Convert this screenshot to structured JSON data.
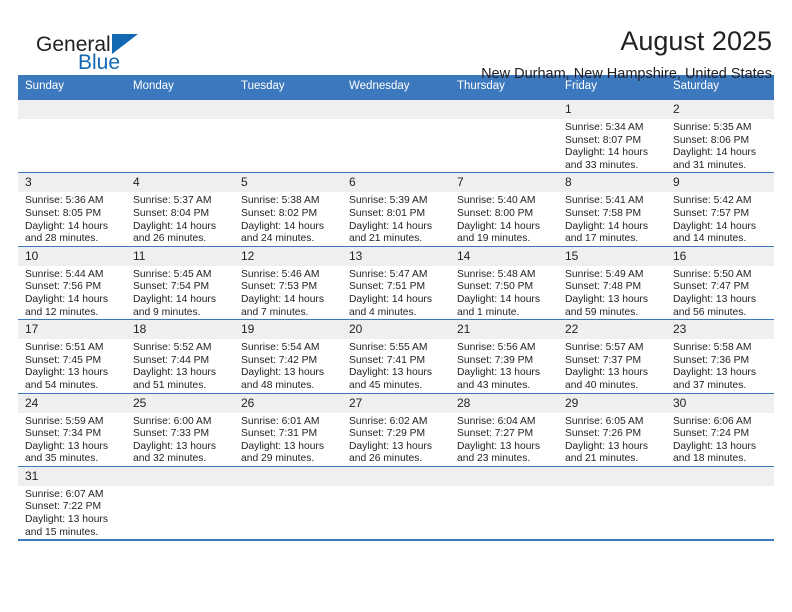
{
  "brand": {
    "name_part1": "General",
    "name_part2": "Blue",
    "mark": "triangle-icon"
  },
  "header": {
    "title": "August 2025",
    "subtitle": "New Durham, New Hampshire, United States"
  },
  "colors": {
    "header_blue": "#3C78BE",
    "brand_blue": "#1268B3",
    "daynum_band": "#EFEFEF",
    "text": "#231F20"
  },
  "weekday_headers": [
    "Sunday",
    "Monday",
    "Tuesday",
    "Wednesday",
    "Thursday",
    "Friday",
    "Saturday"
  ],
  "weeks": [
    [
      {
        "day": "",
        "sunrise": "",
        "sunset": "",
        "daylight1": "",
        "daylight2": ""
      },
      {
        "day": "",
        "sunrise": "",
        "sunset": "",
        "daylight1": "",
        "daylight2": ""
      },
      {
        "day": "",
        "sunrise": "",
        "sunset": "",
        "daylight1": "",
        "daylight2": ""
      },
      {
        "day": "",
        "sunrise": "",
        "sunset": "",
        "daylight1": "",
        "daylight2": ""
      },
      {
        "day": "",
        "sunrise": "",
        "sunset": "",
        "daylight1": "",
        "daylight2": ""
      },
      {
        "day": "1",
        "sunrise": "Sunrise: 5:34 AM",
        "sunset": "Sunset: 8:07 PM",
        "daylight1": "Daylight: 14 hours",
        "daylight2": "and 33 minutes."
      },
      {
        "day": "2",
        "sunrise": "Sunrise: 5:35 AM",
        "sunset": "Sunset: 8:06 PM",
        "daylight1": "Daylight: 14 hours",
        "daylight2": "and 31 minutes."
      }
    ],
    [
      {
        "day": "3",
        "sunrise": "Sunrise: 5:36 AM",
        "sunset": "Sunset: 8:05 PM",
        "daylight1": "Daylight: 14 hours",
        "daylight2": "and 28 minutes."
      },
      {
        "day": "4",
        "sunrise": "Sunrise: 5:37 AM",
        "sunset": "Sunset: 8:04 PM",
        "daylight1": "Daylight: 14 hours",
        "daylight2": "and 26 minutes."
      },
      {
        "day": "5",
        "sunrise": "Sunrise: 5:38 AM",
        "sunset": "Sunset: 8:02 PM",
        "daylight1": "Daylight: 14 hours",
        "daylight2": "and 24 minutes."
      },
      {
        "day": "6",
        "sunrise": "Sunrise: 5:39 AM",
        "sunset": "Sunset: 8:01 PM",
        "daylight1": "Daylight: 14 hours",
        "daylight2": "and 21 minutes."
      },
      {
        "day": "7",
        "sunrise": "Sunrise: 5:40 AM",
        "sunset": "Sunset: 8:00 PM",
        "daylight1": "Daylight: 14 hours",
        "daylight2": "and 19 minutes."
      },
      {
        "day": "8",
        "sunrise": "Sunrise: 5:41 AM",
        "sunset": "Sunset: 7:58 PM",
        "daylight1": "Daylight: 14 hours",
        "daylight2": "and 17 minutes."
      },
      {
        "day": "9",
        "sunrise": "Sunrise: 5:42 AM",
        "sunset": "Sunset: 7:57 PM",
        "daylight1": "Daylight: 14 hours",
        "daylight2": "and 14 minutes."
      }
    ],
    [
      {
        "day": "10",
        "sunrise": "Sunrise: 5:44 AM",
        "sunset": "Sunset: 7:56 PM",
        "daylight1": "Daylight: 14 hours",
        "daylight2": "and 12 minutes."
      },
      {
        "day": "11",
        "sunrise": "Sunrise: 5:45 AM",
        "sunset": "Sunset: 7:54 PM",
        "daylight1": "Daylight: 14 hours",
        "daylight2": "and 9 minutes."
      },
      {
        "day": "12",
        "sunrise": "Sunrise: 5:46 AM",
        "sunset": "Sunset: 7:53 PM",
        "daylight1": "Daylight: 14 hours",
        "daylight2": "and 7 minutes."
      },
      {
        "day": "13",
        "sunrise": "Sunrise: 5:47 AM",
        "sunset": "Sunset: 7:51 PM",
        "daylight1": "Daylight: 14 hours",
        "daylight2": "and 4 minutes."
      },
      {
        "day": "14",
        "sunrise": "Sunrise: 5:48 AM",
        "sunset": "Sunset: 7:50 PM",
        "daylight1": "Daylight: 14 hours",
        "daylight2": "and 1 minute."
      },
      {
        "day": "15",
        "sunrise": "Sunrise: 5:49 AM",
        "sunset": "Sunset: 7:48 PM",
        "daylight1": "Daylight: 13 hours",
        "daylight2": "and 59 minutes."
      },
      {
        "day": "16",
        "sunrise": "Sunrise: 5:50 AM",
        "sunset": "Sunset: 7:47 PM",
        "daylight1": "Daylight: 13 hours",
        "daylight2": "and 56 minutes."
      }
    ],
    [
      {
        "day": "17",
        "sunrise": "Sunrise: 5:51 AM",
        "sunset": "Sunset: 7:45 PM",
        "daylight1": "Daylight: 13 hours",
        "daylight2": "and 54 minutes."
      },
      {
        "day": "18",
        "sunrise": "Sunrise: 5:52 AM",
        "sunset": "Sunset: 7:44 PM",
        "daylight1": "Daylight: 13 hours",
        "daylight2": "and 51 minutes."
      },
      {
        "day": "19",
        "sunrise": "Sunrise: 5:54 AM",
        "sunset": "Sunset: 7:42 PM",
        "daylight1": "Daylight: 13 hours",
        "daylight2": "and 48 minutes."
      },
      {
        "day": "20",
        "sunrise": "Sunrise: 5:55 AM",
        "sunset": "Sunset: 7:41 PM",
        "daylight1": "Daylight: 13 hours",
        "daylight2": "and 45 minutes."
      },
      {
        "day": "21",
        "sunrise": "Sunrise: 5:56 AM",
        "sunset": "Sunset: 7:39 PM",
        "daylight1": "Daylight: 13 hours",
        "daylight2": "and 43 minutes."
      },
      {
        "day": "22",
        "sunrise": "Sunrise: 5:57 AM",
        "sunset": "Sunset: 7:37 PM",
        "daylight1": "Daylight: 13 hours",
        "daylight2": "and 40 minutes."
      },
      {
        "day": "23",
        "sunrise": "Sunrise: 5:58 AM",
        "sunset": "Sunset: 7:36 PM",
        "daylight1": "Daylight: 13 hours",
        "daylight2": "and 37 minutes."
      }
    ],
    [
      {
        "day": "24",
        "sunrise": "Sunrise: 5:59 AM",
        "sunset": "Sunset: 7:34 PM",
        "daylight1": "Daylight: 13 hours",
        "daylight2": "and 35 minutes."
      },
      {
        "day": "25",
        "sunrise": "Sunrise: 6:00 AM",
        "sunset": "Sunset: 7:33 PM",
        "daylight1": "Daylight: 13 hours",
        "daylight2": "and 32 minutes."
      },
      {
        "day": "26",
        "sunrise": "Sunrise: 6:01 AM",
        "sunset": "Sunset: 7:31 PM",
        "daylight1": "Daylight: 13 hours",
        "daylight2": "and 29 minutes."
      },
      {
        "day": "27",
        "sunrise": "Sunrise: 6:02 AM",
        "sunset": "Sunset: 7:29 PM",
        "daylight1": "Daylight: 13 hours",
        "daylight2": "and 26 minutes."
      },
      {
        "day": "28",
        "sunrise": "Sunrise: 6:04 AM",
        "sunset": "Sunset: 7:27 PM",
        "daylight1": "Daylight: 13 hours",
        "daylight2": "and 23 minutes."
      },
      {
        "day": "29",
        "sunrise": "Sunrise: 6:05 AM",
        "sunset": "Sunset: 7:26 PM",
        "daylight1": "Daylight: 13 hours",
        "daylight2": "and 21 minutes."
      },
      {
        "day": "30",
        "sunrise": "Sunrise: 6:06 AM",
        "sunset": "Sunset: 7:24 PM",
        "daylight1": "Daylight: 13 hours",
        "daylight2": "and 18 minutes."
      }
    ],
    [
      {
        "day": "31",
        "sunrise": "Sunrise: 6:07 AM",
        "sunset": "Sunset: 7:22 PM",
        "daylight1": "Daylight: 13 hours",
        "daylight2": "and 15 minutes."
      },
      {
        "day": "",
        "sunrise": "",
        "sunset": "",
        "daylight1": "",
        "daylight2": ""
      },
      {
        "day": "",
        "sunrise": "",
        "sunset": "",
        "daylight1": "",
        "daylight2": ""
      },
      {
        "day": "",
        "sunrise": "",
        "sunset": "",
        "daylight1": "",
        "daylight2": ""
      },
      {
        "day": "",
        "sunrise": "",
        "sunset": "",
        "daylight1": "",
        "daylight2": ""
      },
      {
        "day": "",
        "sunrise": "",
        "sunset": "",
        "daylight1": "",
        "daylight2": ""
      },
      {
        "day": "",
        "sunrise": "",
        "sunset": "",
        "daylight1": "",
        "daylight2": ""
      }
    ]
  ]
}
